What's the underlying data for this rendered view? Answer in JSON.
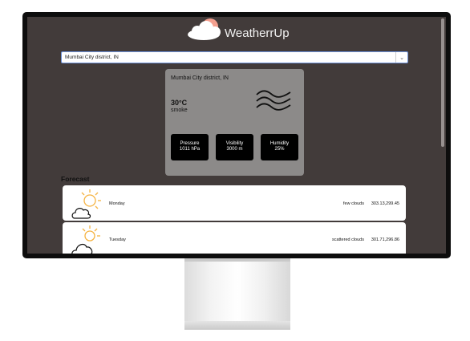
{
  "app": {
    "logo_text": "WeatherrUp"
  },
  "search": {
    "value": "Mumbai City district, IN"
  },
  "current": {
    "location": "Mumbai City district, IN",
    "temperature": "30°C",
    "description": "smoke",
    "icon": "mist-icon",
    "stats": [
      {
        "label": "Pressure",
        "value": "1011 hPa"
      },
      {
        "label": "Visibility",
        "value": "3000 m"
      },
      {
        "label": "Humidity",
        "value": "25%"
      }
    ]
  },
  "forecast": {
    "title": "Forecast",
    "days": [
      {
        "day": "Monday",
        "description": "few clouds",
        "temps": "303.13,299.45",
        "icon": "partly-sunny-icon"
      },
      {
        "day": "Tuesday",
        "description": "scattered clouds",
        "temps": "301.71,296.86",
        "icon": "partly-sunny-icon"
      }
    ]
  },
  "colors": {
    "page_bg": "#423b3a",
    "card_bg": "#8c8a89",
    "sun": "#f5b342",
    "logo_sun": "#f4a08f"
  }
}
